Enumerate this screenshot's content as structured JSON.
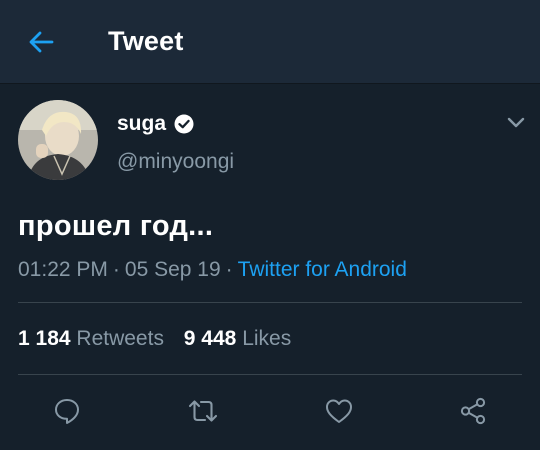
{
  "header": {
    "title": "Tweet",
    "back_icon": "arrow-left-icon"
  },
  "tweet": {
    "author_name": "suga",
    "author_handle": "@minyoongi",
    "verified": true,
    "text": "прошел год...",
    "time": "01:22 PM",
    "date": "05 Sep 19",
    "source": "Twitter for Android",
    "separator": "·"
  },
  "stats": {
    "retweets_count": "1 184",
    "retweets_label": "Retweets",
    "likes_count": "9 448",
    "likes_label": "Likes"
  },
  "actions": [
    {
      "name": "reply",
      "icon": "comment-icon"
    },
    {
      "name": "retweet",
      "icon": "retweet-icon"
    },
    {
      "name": "like",
      "icon": "heart-icon"
    },
    {
      "name": "share",
      "icon": "share-icon"
    }
  ],
  "colors": {
    "background": "#15202b",
    "header": "#1c2938",
    "accent": "#1da1f2",
    "muted": "#8899a6",
    "divider": "#38444d"
  }
}
